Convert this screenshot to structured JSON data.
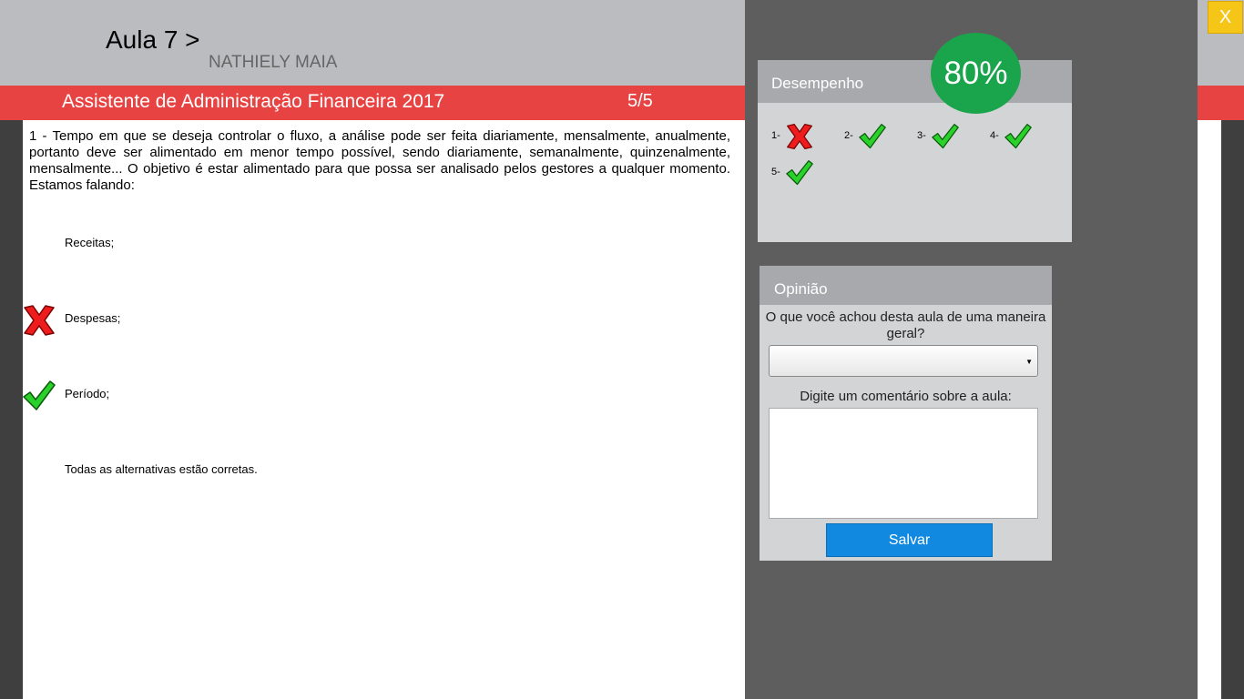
{
  "header": {
    "lesson_title": "Aula 7 >",
    "student_name": "NATHIELY MAIA",
    "course_title": "Assistente de Administração Financeira 2017",
    "progress": "5/5"
  },
  "question": {
    "text": "1 - Tempo em que se deseja controlar o fluxo, a análise pode ser feita diariamente, mensalmente, anualmente, portanto deve ser alimentado em menor tempo possível, sendo diariamente, semanalmente, quinzenalmente, mensalmente... O objetivo é estar alimentado para que possa ser analisado pelos gestores a qualquer momento. Estamos falando:",
    "options": [
      {
        "label": "Receitas;",
        "mark": "none"
      },
      {
        "label": "Despesas;",
        "mark": "wrong-x-icon"
      },
      {
        "label": "Período;",
        "mark": "correct-check-icon"
      },
      {
        "label": "Todas as alternativas estão corretas.",
        "mark": "none"
      }
    ]
  },
  "close_label": "X",
  "performance": {
    "title": "Desempenho",
    "score": "80%",
    "results": [
      {
        "num": "1-",
        "mark": "wrong-x-icon"
      },
      {
        "num": "2-",
        "mark": "correct-check-icon"
      },
      {
        "num": "3-",
        "mark": "correct-check-icon"
      },
      {
        "num": "4-",
        "mark": "correct-check-icon"
      },
      {
        "num": "5-",
        "mark": "correct-check-icon"
      }
    ]
  },
  "opinion": {
    "title": "Opinião",
    "question": "O que você achou desta aula de uma maneira geral?",
    "selected_value": "",
    "comment_label": "Digite um comentário sobre a aula:",
    "comment_value": "",
    "save_label": "Salvar"
  },
  "colors": {
    "header_bg": "#bbbcbf",
    "accent_red": "#e84343",
    "score_green": "#1aa44c",
    "save_blue": "#1289e0",
    "close_yellow": "#f5c518",
    "panel_bg": "#5e5e5e"
  }
}
